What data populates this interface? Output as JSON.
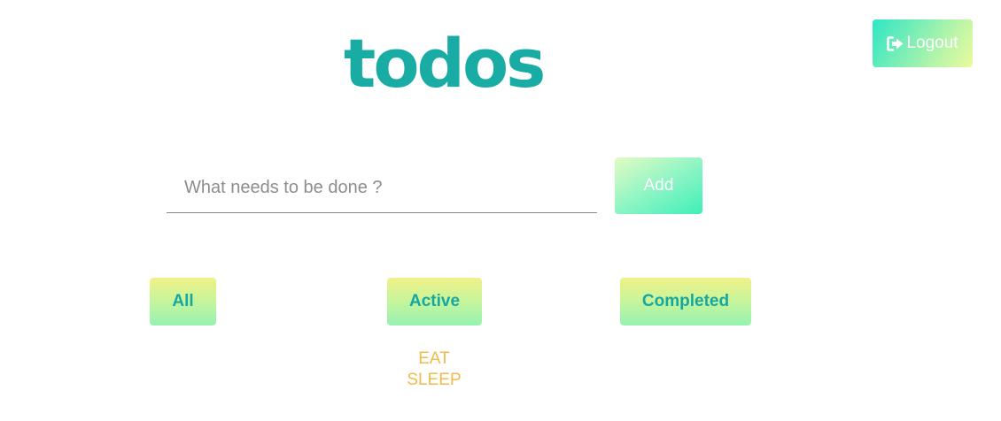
{
  "header": {
    "logout_label": "Logout",
    "logout_icon": "sign-out-icon"
  },
  "app": {
    "title": "todos"
  },
  "new_todo": {
    "placeholder": "What needs to be done ?",
    "value": "",
    "add_label": "Add"
  },
  "filters": [
    {
      "label": "All"
    },
    {
      "label": "Active"
    },
    {
      "label": "Completed"
    }
  ],
  "todos": [
    {
      "text": "EAT"
    },
    {
      "text": "SLEEP"
    }
  ],
  "colors": {
    "title": "#19aca4",
    "filter_text": "#18a6a0",
    "todo_text": "#f0bb4a"
  }
}
